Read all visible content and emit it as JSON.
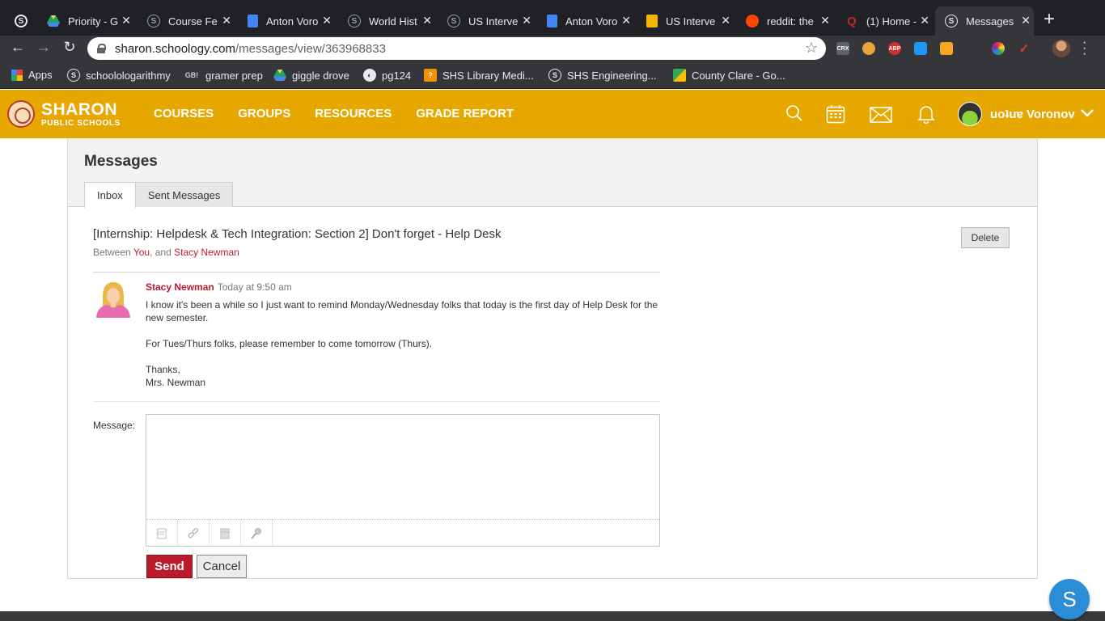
{
  "browser": {
    "tabs": [
      {
        "title": "Priority - G",
        "icon": "google-drive-icon"
      },
      {
        "title": "Course Fe",
        "icon": "schoology-icon"
      },
      {
        "title": "Anton Voro",
        "icon": "google-docs-icon"
      },
      {
        "title": "World Hist",
        "icon": "schoology-icon"
      },
      {
        "title": "US Interve",
        "icon": "schoology-icon"
      },
      {
        "title": "Anton Voro",
        "icon": "google-docs-icon"
      },
      {
        "title": "US Interve",
        "icon": "google-slides-icon"
      },
      {
        "title": "reddit: the",
        "icon": "reddit-icon"
      },
      {
        "title": "(1) Home -",
        "icon": "quora-icon"
      },
      {
        "title": "Messages",
        "icon": "schoology-icon",
        "active": true
      }
    ],
    "first_tab_icon": "S",
    "url_host": "sharon.schoology.com",
    "url_path": "/messages/view/363968833",
    "extensions": [
      "CRX",
      "ABP"
    ],
    "bookmarks": [
      {
        "label": "Apps",
        "icon": "apps-grid-icon"
      },
      {
        "label": "schoolologarithmy",
        "icon": "schoology-icon"
      },
      {
        "label": "gramer prep",
        "icon": "gb-icon",
        "icon_text": "GB!"
      },
      {
        "label": "giggle drove",
        "icon": "google-drive-icon"
      },
      {
        "label": "pg124",
        "icon": "globe-icon"
      },
      {
        "label": "SHS Library Medi...",
        "icon": "library-icon"
      },
      {
        "label": "SHS Engineering...",
        "icon": "schoology-icon"
      },
      {
        "label": "County Clare - Go...",
        "icon": "google-maps-icon"
      }
    ]
  },
  "header": {
    "brand_name": "SHARON",
    "brand_sub": "PUBLIC SCHOOLS",
    "nav": [
      "COURSES",
      "GROUPS",
      "RESOURCES",
      "GRADE REPORT"
    ],
    "user_name": "uoʇuɐ Voronov",
    "accent_color": "#e6a800"
  },
  "page": {
    "title": "Messages",
    "tabs": [
      "Inbox",
      "Sent Messages"
    ],
    "active_tab": "Inbox"
  },
  "message": {
    "subject": "[Internship: Helpdesk & Tech Integration: Section 2] Don't forget - Help Desk",
    "between_prefix": "Between",
    "between_you": "You",
    "between_and": ", and",
    "between_other": "Stacy Newman",
    "delete_label": "Delete",
    "sender": "Stacy Newman",
    "time": "Today at 9:50 am",
    "body": [
      "I know it's been a while so I just want to remind Monday/Wednesday folks that today is the first day of Help Desk for the new semester.",
      "For Tues/Thurs folks, please remember to come tomorrow (Thurs).",
      "Thanks,",
      "Mrs. Newman"
    ]
  },
  "reply": {
    "label": "Message:",
    "value": "",
    "send_label": "Send",
    "cancel_label": "Cancel",
    "tools": [
      "attach-file-icon",
      "link-icon",
      "resource-icon",
      "record-audio-icon"
    ]
  },
  "help": {
    "label": "S"
  },
  "colors": {
    "link": "#ba1c2e",
    "send": "#ba1c2e",
    "header": "#e6a800"
  }
}
